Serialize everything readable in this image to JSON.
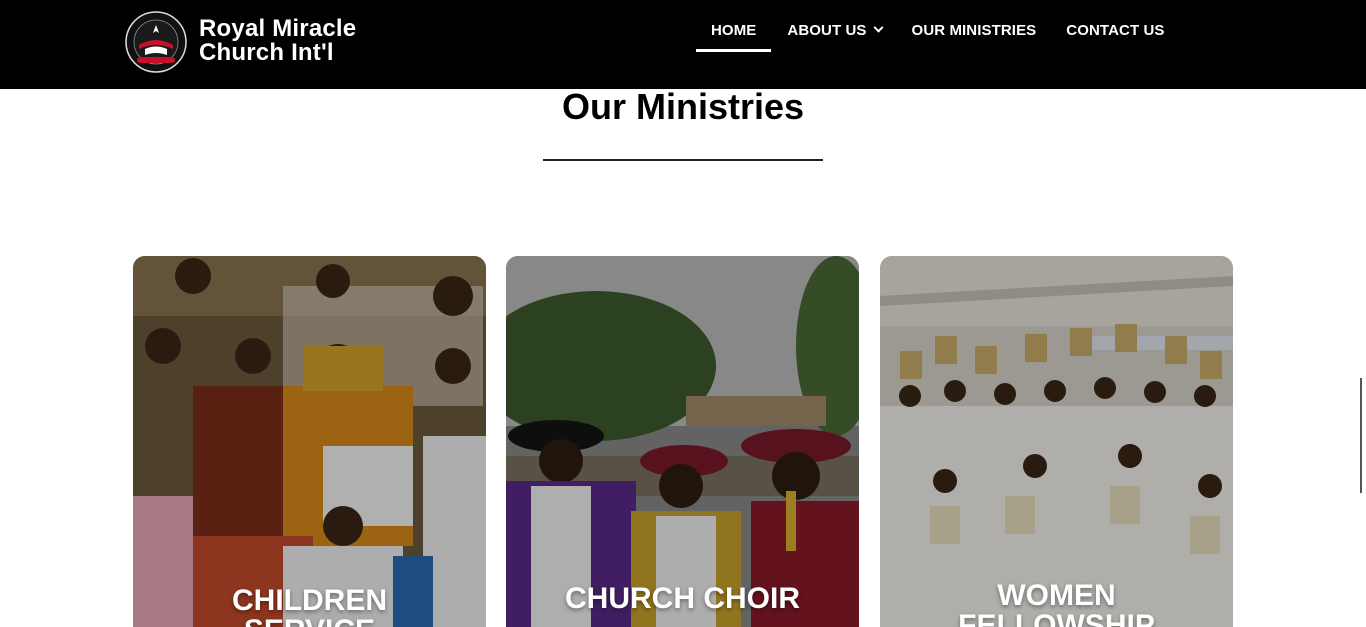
{
  "header": {
    "brand_line1": "Royal Miracle",
    "brand_line2": "Church Int'l",
    "logo_icon": "church-seal-logo",
    "nav": [
      {
        "label": "HOME",
        "active": true
      },
      {
        "label": "ABOUT US",
        "has_dropdown": true
      },
      {
        "label": "OUR MINISTRIES"
      },
      {
        "label": "CONTACT US"
      }
    ]
  },
  "section": {
    "title": "Our Ministries"
  },
  "cards": [
    {
      "label_line1": "CHILDREN",
      "label_line2": "SERVICE",
      "image": "children-photo"
    },
    {
      "label_line1": "CHURCH CHOIR",
      "label_line2": "",
      "image": "choir-photo"
    },
    {
      "label_line1": "WOMEN",
      "label_line2": "FELLOWSHIP",
      "image": "women-photo"
    }
  ],
  "colors": {
    "header_bg": "#000000",
    "text_on_dark": "#ffffff",
    "accent_red": "#c8102e"
  }
}
